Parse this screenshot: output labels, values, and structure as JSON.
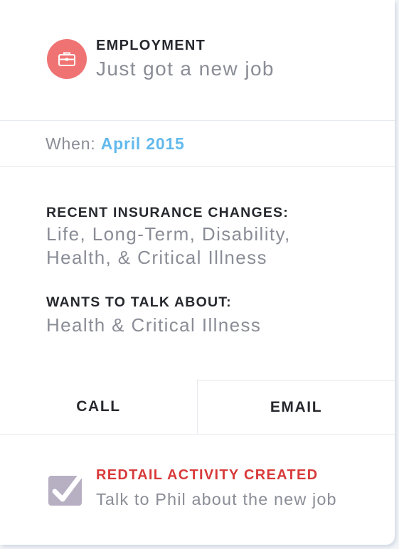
{
  "header": {
    "category": "EMPLOYMENT",
    "title": "Just got a new job",
    "icon": "briefcase-icon",
    "icon_bg": "#f07373"
  },
  "when": {
    "label": "When:",
    "value": "April 2015",
    "value_color": "#62b9ec"
  },
  "details": {
    "insurance_title": "RECENT INSURANCE CHANGES:",
    "insurance_line1": "Life, Long-Term, Disability,",
    "insurance_line2": "Health, & Critical Illness",
    "talk_title": "WANTS TO TALK ABOUT:",
    "talk_value": "Health & Critical Illness"
  },
  "actions": {
    "call_label": "CALL",
    "email_label": "EMAIL"
  },
  "activity": {
    "title": "REDTAIL ACTIVITY CREATED",
    "description": "Talk to Phil about the new job",
    "icon": "checkbox-checked-icon",
    "title_color": "#d83a3a"
  }
}
